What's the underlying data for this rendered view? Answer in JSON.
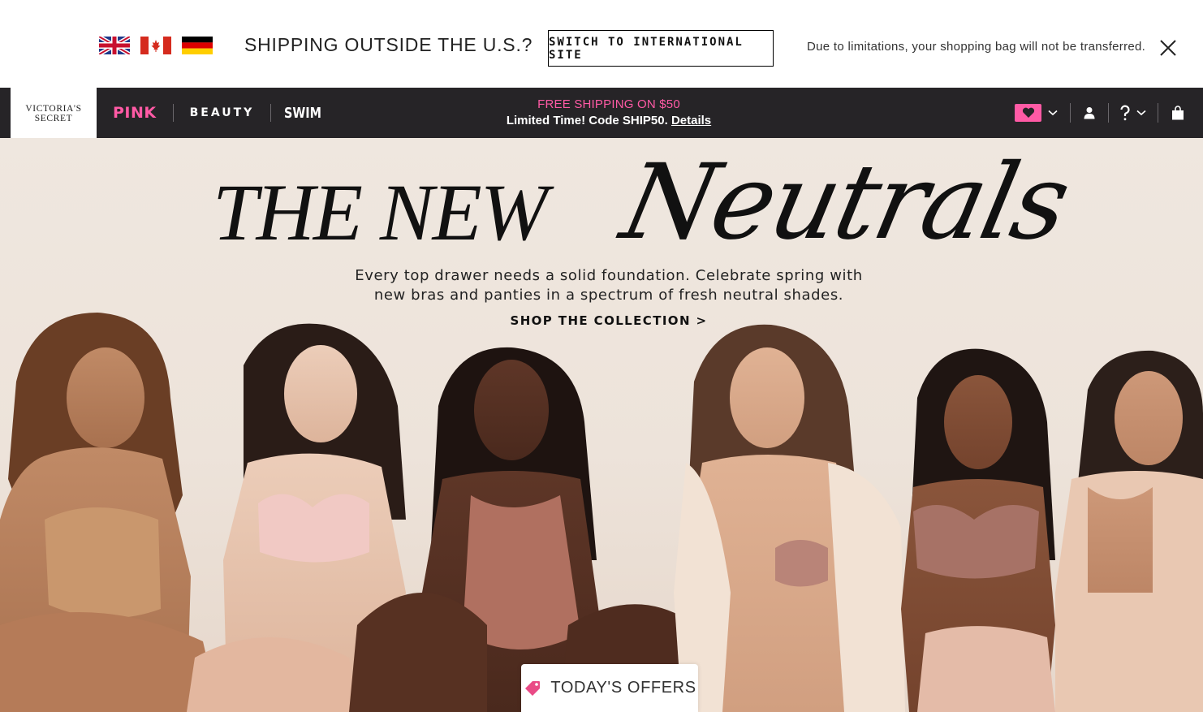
{
  "intl_banner": {
    "flags": [
      "flag-uk-icon",
      "flag-canada-icon",
      "flag-germany-icon"
    ],
    "question": "SHIPPING OUTSIDE THE U.S.?",
    "switch_button": "SWITCH TO INTERNATIONAL SITE",
    "note": "Due to limitations, your shopping bag will not be transferred."
  },
  "nav": {
    "logo_line1": "VICTORIA'S",
    "logo_line2": "SECRET",
    "links": [
      "PINK",
      "BEAUTY",
      "SWIM"
    ],
    "promo_line1": "FREE SHIPPING ON $50",
    "promo_line2": "Limited Time! Code SHIP50.",
    "promo_link": "Details",
    "icons": [
      "heart-icon",
      "account-icon",
      "help-icon",
      "shopping-bag-icon"
    ]
  },
  "hero": {
    "title_part1": "THE NEW",
    "title_part2": "Neutrals",
    "copy_line1": "Every top drawer needs a solid foundation. Celebrate spring with",
    "copy_line2": "new bras and panties in a spectrum of fresh neutral shades.",
    "cta": "SHOP THE COLLECTION >",
    "offers_button": "TODAY'S OFFERS"
  },
  "colors": {
    "nav_background": "#262427",
    "brand_pink": "#ff5aa5",
    "hero_background": "#efe7df"
  }
}
